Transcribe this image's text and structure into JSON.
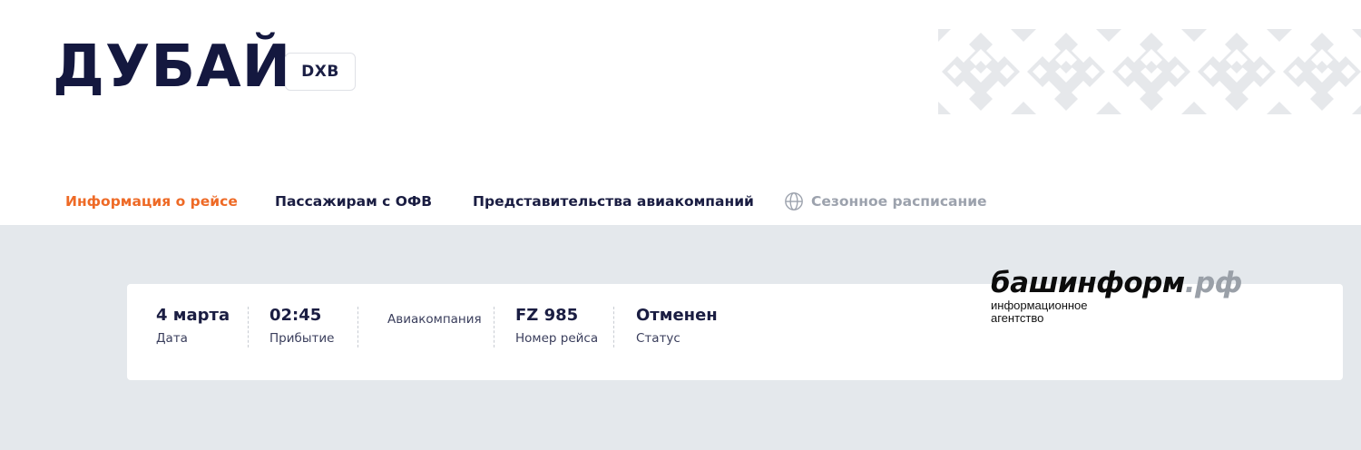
{
  "header": {
    "city": "ДУБАЙ",
    "iata": "DXB"
  },
  "nav": {
    "tabs": [
      {
        "label": "Информация о рейсе",
        "state": "active"
      },
      {
        "label": "Пассажирам с ОФВ",
        "state": "normal"
      },
      {
        "label": "Представительства авиакомпаний",
        "state": "normal"
      },
      {
        "label": "Сезонное расписание",
        "state": "muted",
        "icon": "globe-icon"
      }
    ]
  },
  "flight": {
    "date": {
      "value": "4 марта",
      "label": "Дата"
    },
    "arrival": {
      "value": "02:45",
      "label": "Прибытие"
    },
    "airline": {
      "label": "Авиакомпания"
    },
    "flight_number": {
      "value": "FZ 985",
      "label": "Номер рейса"
    },
    "status": {
      "value": "Отменен",
      "label": "Статус"
    }
  },
  "watermark": {
    "brand": "башинформ",
    "tld": ".рф",
    "subtitle_line1": "информационное",
    "subtitle_line2": "агентство"
  },
  "colors": {
    "accent": "#ee6a26",
    "navy": "#14183f",
    "muted": "#9ca2ad",
    "background": "#e4e8ec"
  }
}
